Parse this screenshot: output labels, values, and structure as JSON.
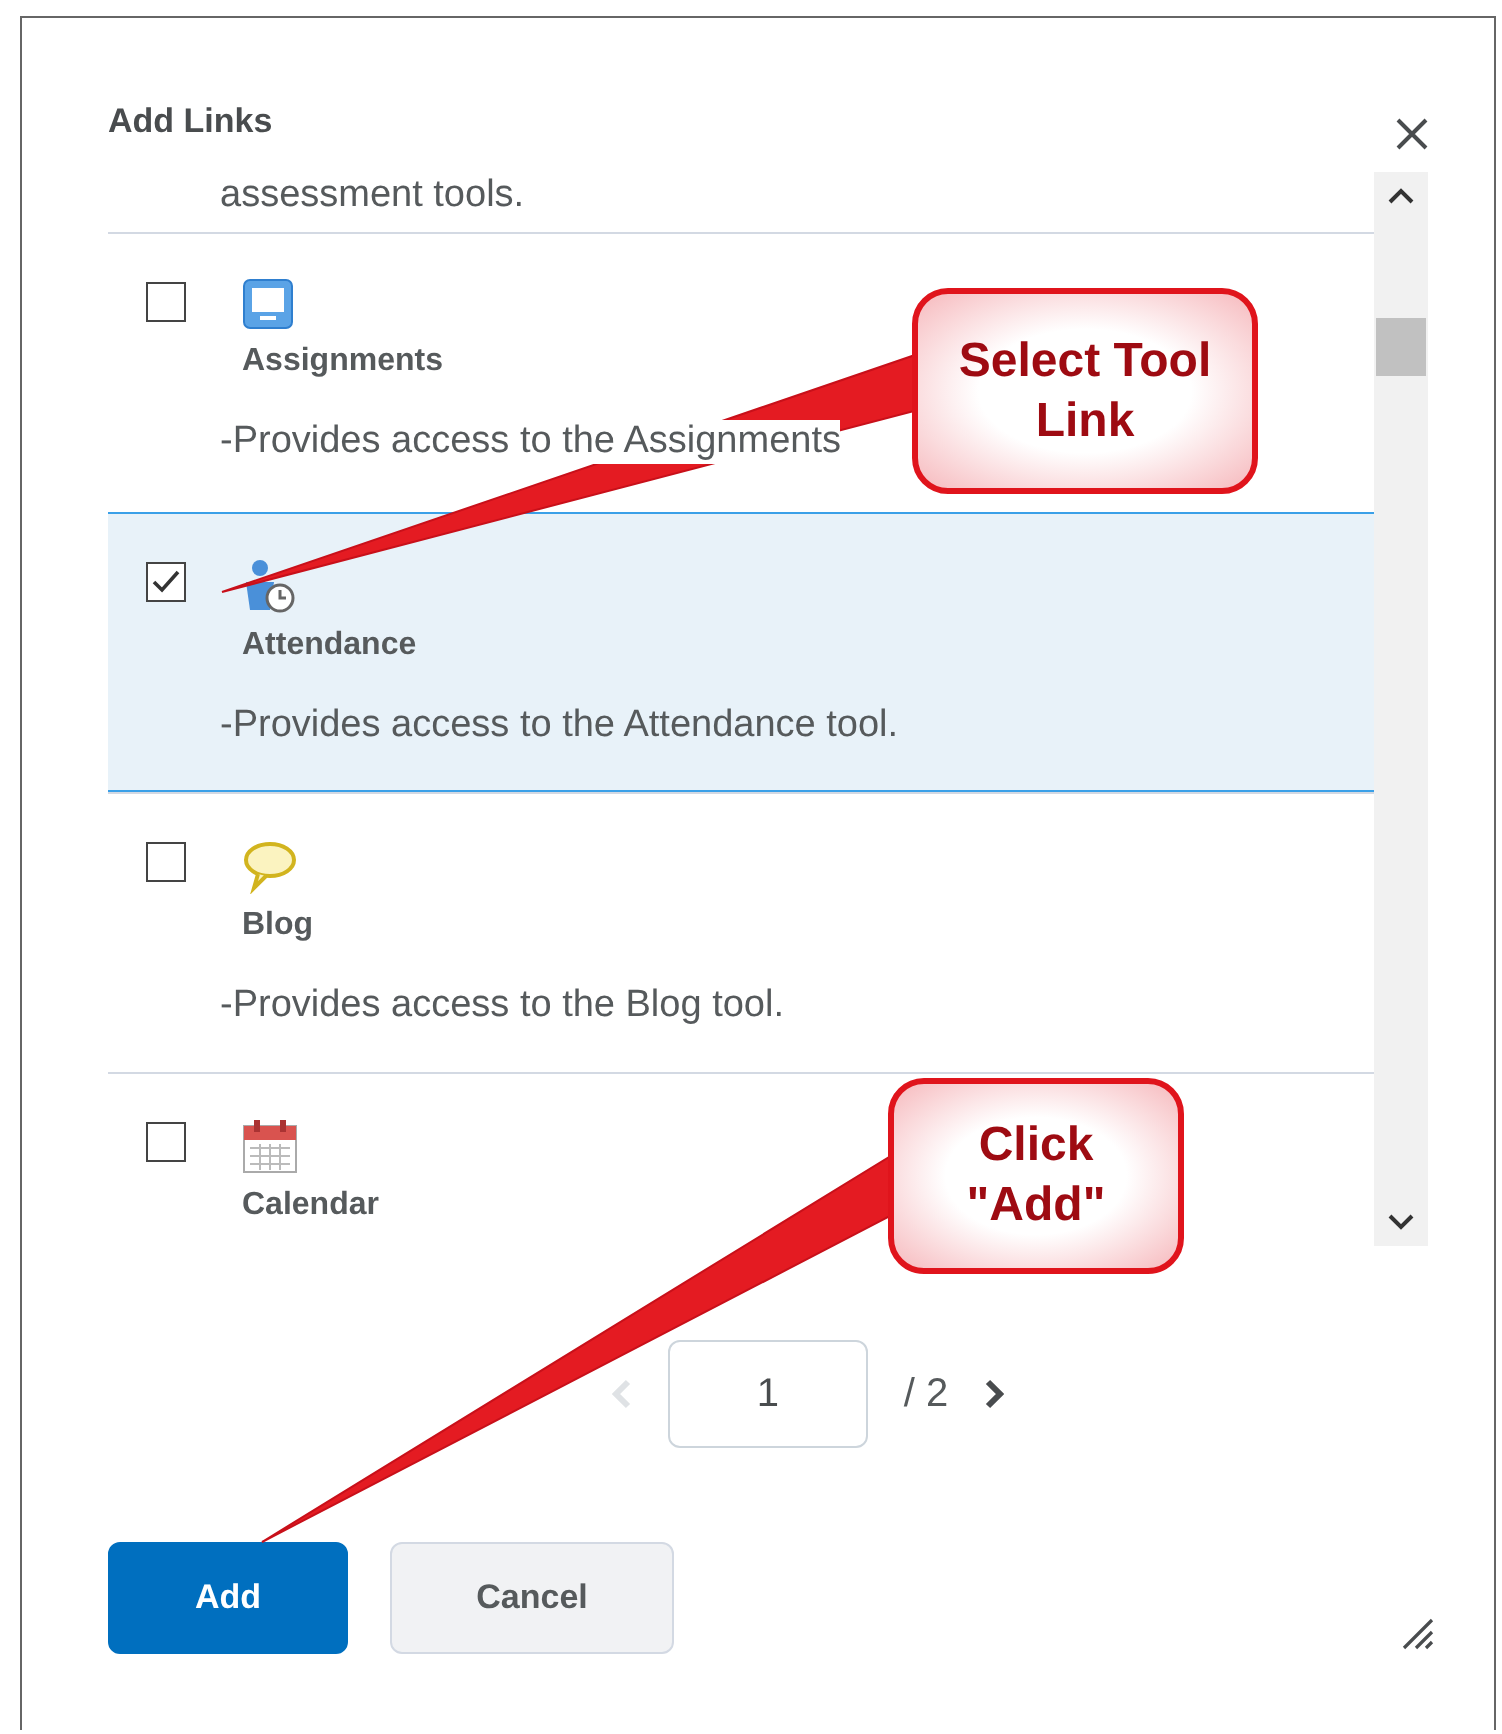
{
  "dialog": {
    "title": "Add Links"
  },
  "list": {
    "previous_text": "assessment tools.",
    "items": [
      {
        "label": "Assignments",
        "description": "-Provides access to the Assignments",
        "checked": false
      },
      {
        "label": "Attendance",
        "description": "-Provides access to the Attendance tool.",
        "checked": true
      },
      {
        "label": "Blog",
        "description": "-Provides access to the Blog tool.",
        "checked": false
      },
      {
        "label": "Calendar",
        "checked": false
      }
    ]
  },
  "pagination": {
    "previous_disabled": true,
    "page": "1",
    "total": "/ 2"
  },
  "buttons": [
    {
      "label": "Add",
      "kind": "primary"
    },
    {
      "label": "Cancel",
      "kind": "secondary"
    }
  ],
  "callouts": [
    {
      "text": "Select Tool Link"
    },
    {
      "text": "Click \"Add\""
    }
  ]
}
